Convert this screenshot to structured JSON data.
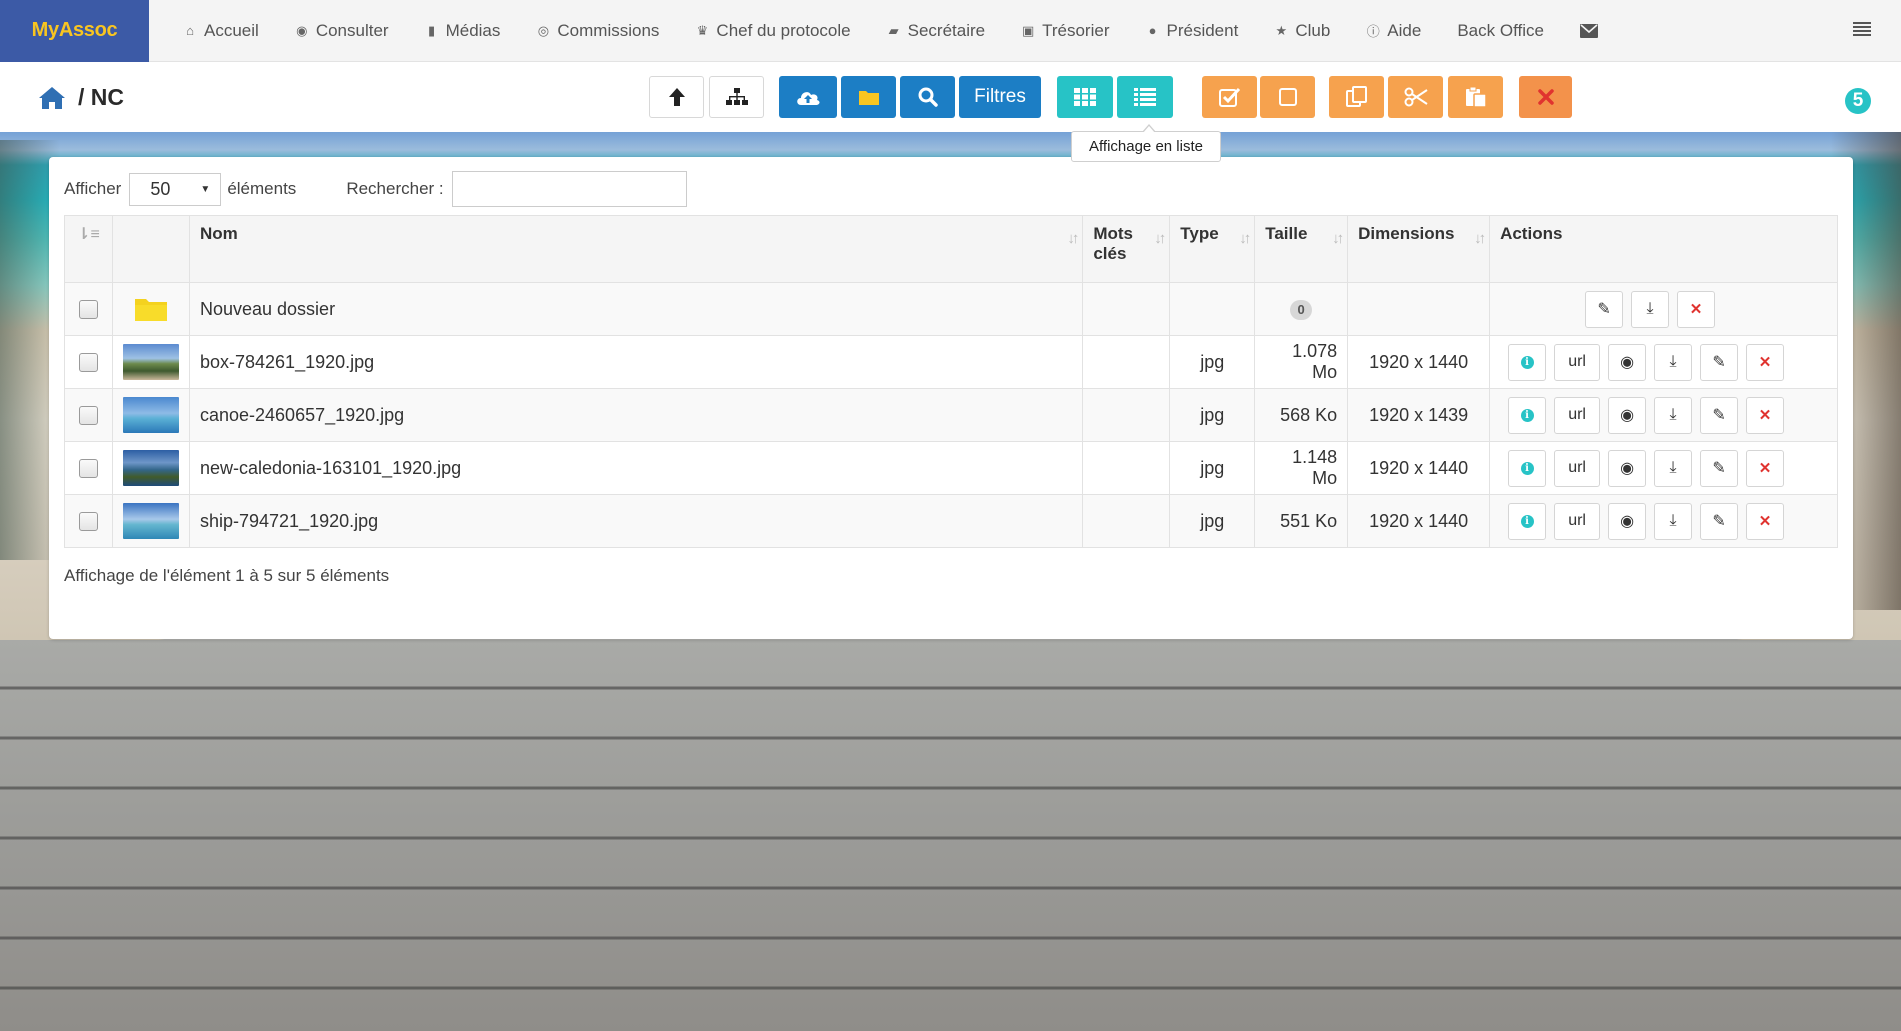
{
  "app": {
    "brand": "MyAssoc"
  },
  "nav": {
    "items": [
      {
        "label": "Accueil",
        "icon": "home-icon"
      },
      {
        "label": "Consulter",
        "icon": "eye-icon"
      },
      {
        "label": "Médias",
        "icon": "file-icon"
      },
      {
        "label": "Commissions",
        "icon": "user-circle-icon"
      },
      {
        "label": "Chef du protocole",
        "icon": "trophy-icon"
      },
      {
        "label": "Secrétaire",
        "icon": "book-icon"
      },
      {
        "label": "Trésorier",
        "icon": "money-icon"
      },
      {
        "label": "Président",
        "icon": "globe-icon"
      },
      {
        "label": "Club",
        "icon": "star-icon"
      },
      {
        "label": "Aide",
        "icon": "info-icon"
      },
      {
        "label": "Back Office",
        "icon": ""
      }
    ],
    "mail_icon": "envelope-icon",
    "menu_icon": "hamburger-icon"
  },
  "toolbar": {
    "breadcrumb": "/ NC",
    "filters_label": "Filtres",
    "tooltip": "Affichage en liste",
    "badge": "5"
  },
  "list": {
    "show_label": "Afficher",
    "page_size": "50",
    "elements_label": "éléments",
    "search_label": "Rechercher :",
    "search_value": "",
    "columns": [
      "Nom",
      "Mots clés",
      "Type",
      "Taille",
      "Dimensions",
      "Actions"
    ],
    "folder": {
      "name": "Nouveau dossier",
      "count": "0"
    },
    "url_label": "url",
    "rows": [
      {
        "name": "box-784261_1920.jpg",
        "keywords": "",
        "type": "jpg",
        "size": "1.078 Mo",
        "dimensions": "1920 x 1440"
      },
      {
        "name": "canoe-2460657_1920.jpg",
        "keywords": "",
        "type": "jpg",
        "size": "568 Ko",
        "dimensions": "1920 x 1439"
      },
      {
        "name": "new-caledonia-163101_1920.jpg",
        "keywords": "",
        "type": "jpg",
        "size": "1.148 Mo",
        "dimensions": "1920 x 1440"
      },
      {
        "name": "ship-794721_1920.jpg",
        "keywords": "",
        "type": "jpg",
        "size": "551 Ko",
        "dimensions": "1920 x 1440"
      }
    ],
    "footer": "Affichage de l'élément 1 à 5 sur 5 éléments"
  },
  "colors": {
    "brand_bg": "#3c5aa6",
    "brand_text": "#f8c521",
    "blue": "#1c7ec5",
    "teal": "#27c3c6",
    "orange": "#f6a24e",
    "danger": "#e0332f"
  }
}
